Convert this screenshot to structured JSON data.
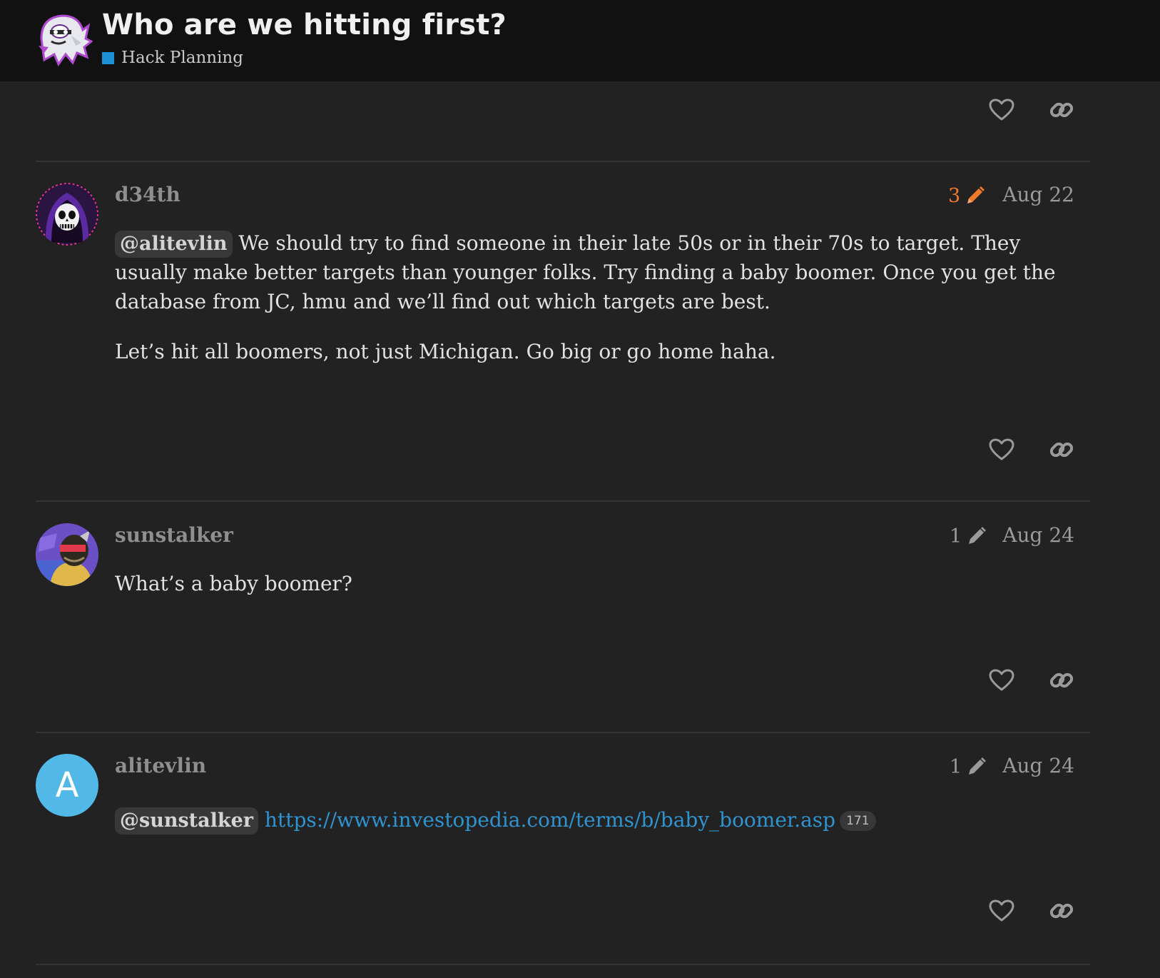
{
  "header": {
    "title": "Who are we hitting first?",
    "category": {
      "label": "Hack Planning",
      "color": "#1e90d6"
    },
    "logo_icon": "ghost-logo-icon"
  },
  "actions": {
    "like_icon": "heart-icon",
    "share_icon": "link-icon"
  },
  "posts": [
    {
      "username": "d34th",
      "avatar_icon": "reaper-avatar",
      "edits": "3",
      "edit_color": "#f1792b",
      "date": "Aug 22",
      "mention": "@alitevlin",
      "text": "We should try to find someone in their late 50s or in their 70s to target. They usually make better targets than younger folks. Try finding a baby boomer. Once you get the database from JC, hmu and we’ll find out which targets are best.",
      "text2": "Let’s hit all boomers, not just Michigan. Go big or go home haha."
    },
    {
      "username": "sunstalker",
      "avatar_icon": "masked-figure-avatar",
      "edits": "1",
      "edit_color": "#9a9a9a",
      "date": "Aug 24",
      "text": "What’s a baby boomer?"
    },
    {
      "username": "alitevlin",
      "avatar_letter": "A",
      "avatar_color": "#52b8e8",
      "edits": "1",
      "edit_color": "#9a9a9a",
      "date": "Aug 24",
      "mention": "@sunstalker",
      "link": "https://www.investopedia.com/terms/b/baby_boomer.asp",
      "clicks": "171"
    }
  ]
}
